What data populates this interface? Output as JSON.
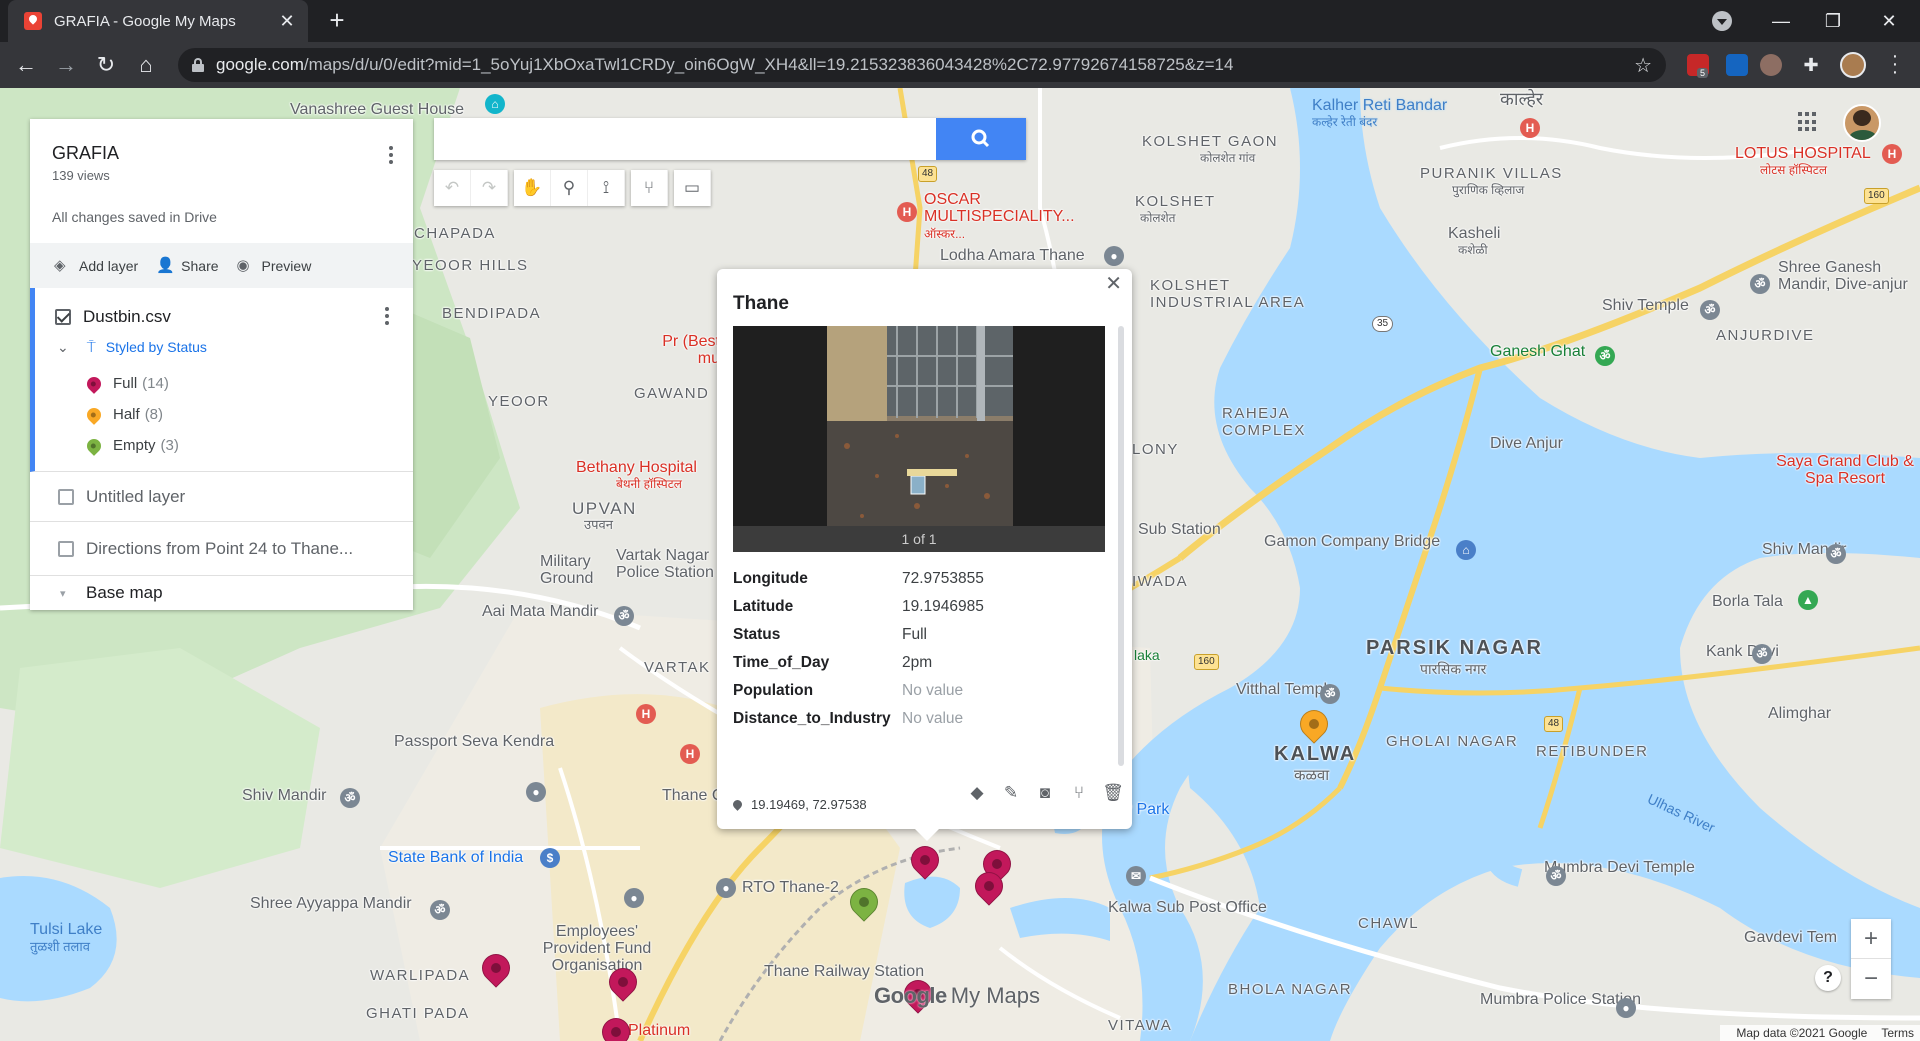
{
  "browser": {
    "tab_title": "GRAFIA - Google My Maps",
    "tab_close": "✕",
    "new_tab": "+",
    "url_host": "google.com",
    "url_path": "/maps/d/u/0/edit?mid=1_5oYuj1XbOxaTwl1CRDy_oin6OgW_XH4&ll=19.215323836043428%2C72.97792674158725&z=14",
    "ext_badge": "5"
  },
  "panel": {
    "map_title": "GRAFIA",
    "views": "139 views",
    "saved_status": "All changes saved in Drive",
    "actions": {
      "add_layer": "Add layer",
      "share": "Share",
      "preview": "Preview"
    },
    "layer1": {
      "name": "Dustbin.csv",
      "styled_by": "Styled by Status",
      "legend": [
        {
          "label": "Full",
          "count": "(14)",
          "color": "#c2185b"
        },
        {
          "label": "Half",
          "count": "(8)",
          "color": "#f9a825"
        },
        {
          "label": "Empty",
          "count": "(3)",
          "color": "#7cb342"
        }
      ]
    },
    "layer2": {
      "name": "Untitled layer"
    },
    "layer3": {
      "name": "Directions from Point 24 to Thane..."
    },
    "base_map": "Base map"
  },
  "search": {
    "placeholder": ""
  },
  "info": {
    "title": "Thane",
    "photo_caption": "1 of 1",
    "fields": [
      {
        "key": "Longitude",
        "value": "72.9753855"
      },
      {
        "key": "Latitude",
        "value": "19.1946985"
      },
      {
        "key": "Status",
        "value": "Full"
      },
      {
        "key": "Time_of_Day",
        "value": "2pm"
      },
      {
        "key": "Population",
        "value": "No value"
      },
      {
        "key": "Distance_to_Industry",
        "value": "No value"
      }
    ],
    "coordinates": "19.19469, 72.97538"
  },
  "map": {
    "labels": [
      {
        "t": "Vanashree Guest House",
        "c": ""
      },
      {
        "t": "Kalher Reti Bandar",
        "c": "water"
      },
      {
        "t": "कल्हेर रेती बंदर",
        "c": "water"
      },
      {
        "t": "काल्हेर",
        "c": ""
      },
      {
        "t": "KOLSHET GAON",
        "c": "area"
      },
      {
        "t": "कोलशेत गांव",
        "c": ""
      },
      {
        "t": "PURANIK VILLAS",
        "c": "area"
      },
      {
        "t": "पुराणिक व्हिलाज",
        "c": ""
      },
      {
        "t": "LOTUS HOSPITAL",
        "c": "red"
      },
      {
        "t": "लोटस हॉस्पिटल",
        "c": "red"
      },
      {
        "t": "KOLSHET",
        "c": "area"
      },
      {
        "t": "कोलशेत",
        "c": ""
      },
      {
        "t": "Kasheli",
        "c": ""
      },
      {
        "t": "कशेळी",
        "c": ""
      },
      {
        "t": "OSCAR MULTISPECIALITY...",
        "c": "red"
      },
      {
        "t": "ऑस्कर...",
        "c": "red"
      },
      {
        "t": "Lodha Amara Thane",
        "c": ""
      },
      {
        "t": "CHAPADA",
        "c": "area"
      },
      {
        "t": "YEOOR HILLS",
        "c": "area"
      },
      {
        "t": "BENDIPADA",
        "c": "area"
      },
      {
        "t": "KOLSHET INDUSTRIAL AREA",
        "c": "area"
      },
      {
        "t": "Shree Ganesh Mandir, Dive-anjur",
        "c": ""
      },
      {
        "t": "Shiv Temple",
        "c": ""
      },
      {
        "t": "ANJURDIVE",
        "c": "area"
      },
      {
        "t": "Ganesh Ghat",
        "c": "green"
      },
      {
        "t": "YEOOR",
        "c": "area"
      },
      {
        "t": "GAWAND",
        "c": "area"
      },
      {
        "t": "RAHEJA COMPLEX",
        "c": "area"
      },
      {
        "t": "Dive Anjur",
        "c": ""
      },
      {
        "t": "Bethany Hospital",
        "c": "red"
      },
      {
        "t": "बेथनी हॉस्पिटल",
        "c": "red"
      },
      {
        "t": "Saya Grand Club & Spa Resort",
        "c": "red"
      },
      {
        "t": "UPVAN",
        "c": "area"
      },
      {
        "t": "उपवन",
        "c": ""
      },
      {
        "t": "Sub Station",
        "c": ""
      },
      {
        "t": "Gamon Company Bridge",
        "c": ""
      },
      {
        "t": "Shiv Mandir",
        "c": ""
      },
      {
        "t": "Military Ground",
        "c": ""
      },
      {
        "t": "Vartak Nagar Police Station",
        "c": ""
      },
      {
        "t": "Borla Tala",
        "c": ""
      },
      {
        "t": "Aai Mata Mandir",
        "c": ""
      },
      {
        "t": "PARSIK NAGAR",
        "c": "big"
      },
      {
        "t": "पारसिक नगर",
        "c": ""
      },
      {
        "t": "Kank Devi",
        "c": ""
      },
      {
        "t": "VARTAK",
        "c": "area"
      },
      {
        "t": "Vitthal Temple",
        "c": ""
      },
      {
        "t": "Alimghar",
        "c": ""
      },
      {
        "t": "Passport Seva Kendra",
        "c": ""
      },
      {
        "t": "GHOLAI NAGAR",
        "c": "area"
      },
      {
        "t": "RETIBUNDER",
        "c": "area"
      },
      {
        "t": "KALWA",
        "c": "big"
      },
      {
        "t": "कळवा",
        "c": ""
      },
      {
        "t": "Shiv Mandir",
        "c": ""
      },
      {
        "t": "Thane Co",
        "c": ""
      },
      {
        "t": "Ulhas River",
        "c": "water"
      },
      {
        "t": "State Bank of India",
        "c": "blue"
      },
      {
        "t": "RTO Thane-2",
        "c": ""
      },
      {
        "t": "Mumbra Devi Temple",
        "c": ""
      },
      {
        "t": "Shree Ayyappa Mandir",
        "c": ""
      },
      {
        "t": "Kalwa Sub Post Office",
        "c": ""
      },
      {
        "t": "Tulsi Lake",
        "c": "water"
      },
      {
        "t": "तुळशी तलाव",
        "c": "water"
      },
      {
        "t": "Employees' Provident Fund Organisation",
        "c": ""
      },
      {
        "t": "CHAWL",
        "c": "area"
      },
      {
        "t": "Gavdevi Tem",
        "c": ""
      },
      {
        "t": "WARLIPADA",
        "c": "area"
      },
      {
        "t": "Thane Railway Station",
        "c": ""
      },
      {
        "t": "BHOLA NAGAR",
        "c": "area"
      },
      {
        "t": "Mumbra Police Station",
        "c": ""
      },
      {
        "t": "GHATI PADA",
        "c": "area"
      },
      {
        "t": "Platinum",
        "c": "red"
      },
      {
        "t": "VITAWA",
        "c": "area"
      },
      {
        "t": "LONY",
        "c": "area"
      },
      {
        "t": "IWADA",
        "c": "area"
      },
      {
        "t": "Bio ty Park",
        "c": "green"
      },
      {
        "t": "laka",
        "c": "blue"
      },
      {
        "t": "Pr (Best mu",
        "c": "red"
      }
    ],
    "roads": [
      "48",
      "160",
      "35",
      "160",
      "48",
      "160"
    ],
    "pins": [
      {
        "status": "Full"
      },
      {
        "status": "Full"
      },
      {
        "status": "Full"
      },
      {
        "status": "Full"
      },
      {
        "status": "Full"
      },
      {
        "status": "Full"
      },
      {
        "status": "Full"
      },
      {
        "status": "Half"
      },
      {
        "status": "Empty"
      }
    ]
  },
  "footer": {
    "logo_google": "Google",
    "logo_mymaps": "My Maps",
    "map_data": "Map data ©2021 Google",
    "terms": "Terms",
    "zoom_in": "+",
    "zoom_out": "−",
    "help": "?"
  }
}
